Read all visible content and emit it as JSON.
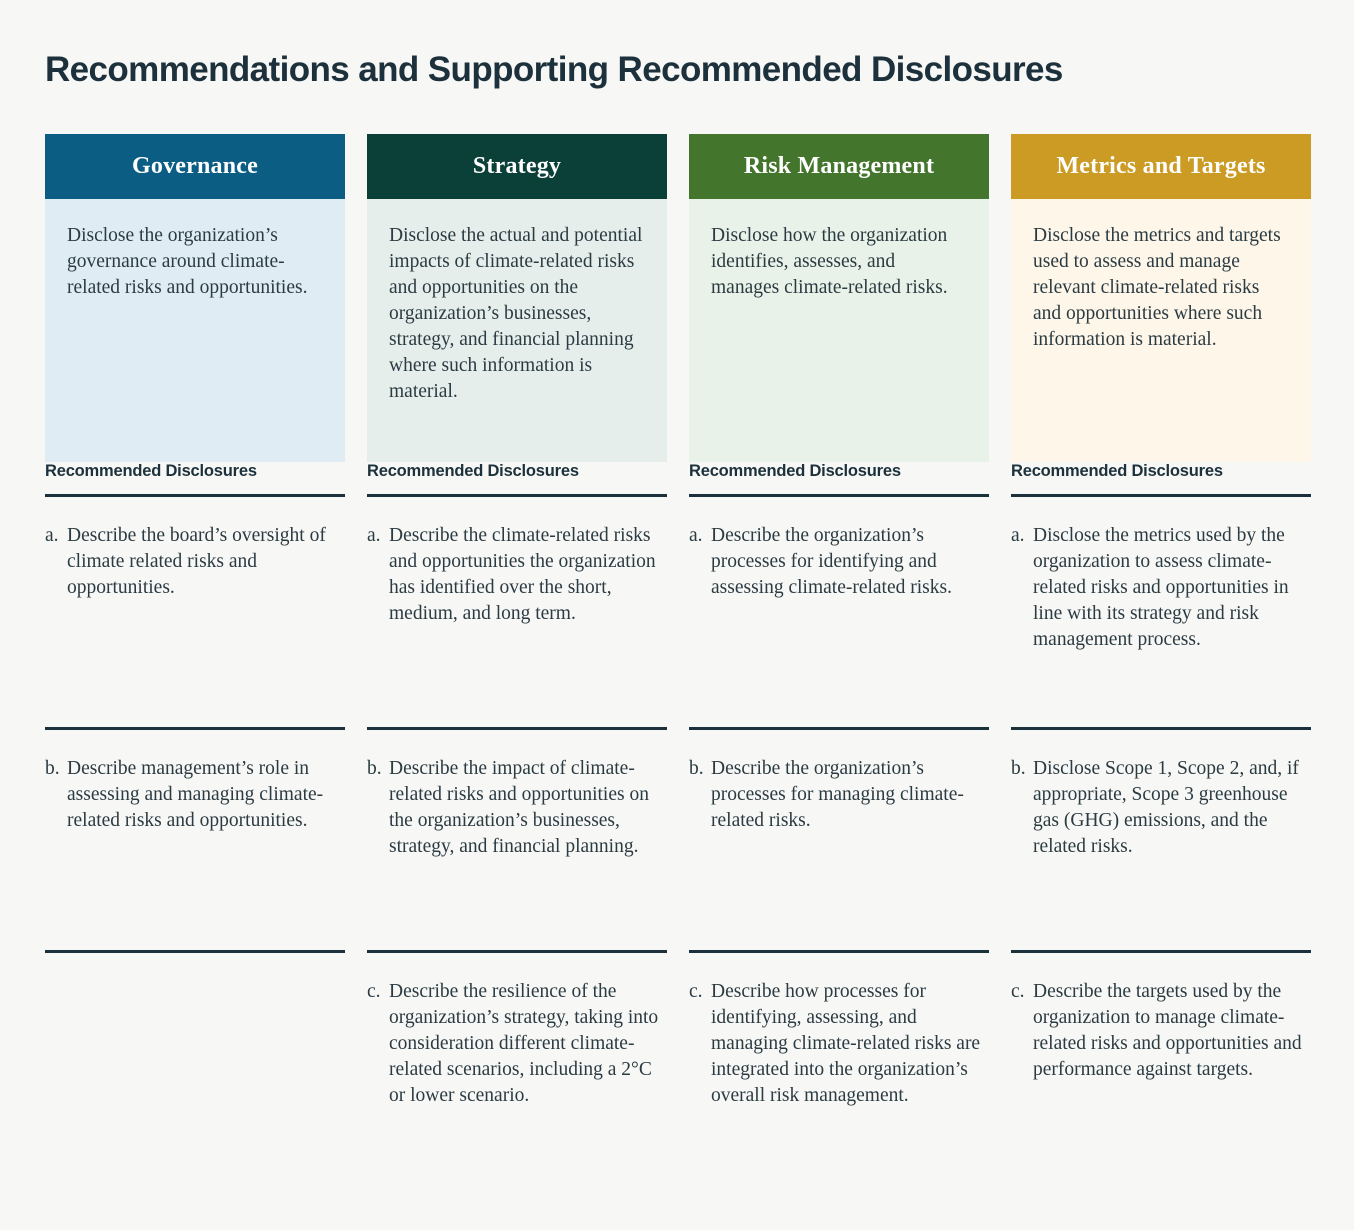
{
  "page": {
    "title": "Recommendations and Supporting Recommended Disclosures",
    "background_color": "#f7f7f5",
    "text_color": "#2b3b42",
    "rule_color": "#1c313c"
  },
  "columns": [
    {
      "id": "governance",
      "header": "Governance",
      "header_bg": "#0b5d84",
      "panel_bg": "#e0ecf4",
      "description": "Disclose the organization’s governance around climate- related risks and opportunities.",
      "disclosures_title": "Recommended Disclosures",
      "items": [
        {
          "marker": "a.",
          "text": "Describe the board’s oversight of climate related risks and opportunities."
        },
        {
          "marker": "b.",
          "text": "Describe management’s role in assessing and managing climate-related risks and opportunities."
        },
        {
          "marker": "",
          "text": ""
        }
      ]
    },
    {
      "id": "strategy",
      "header": "Strategy",
      "header_bg": "#0a4038",
      "panel_bg": "#e5eeeb",
      "description": "Disclose the actual and potential impacts of climate-related risks and opportunities on the organization’s businesses, strategy, and financial planning where such information is material.",
      "disclosures_title": "Recommended Disclosures",
      "items": [
        {
          "marker": "a.",
          "text": "Describe the climate-related risks and opportunities the organization has identified over the short, medium, and long term."
        },
        {
          "marker": "b.",
          "text": "Describe the impact of climate-related risks and opportunities on the organization’s businesses, strategy, and financial planning."
        },
        {
          "marker": "c.",
          "text": "Describe the resilience of the organization’s strategy, taking into consideration different climate-related scenarios, including a 2°C or lower scenario."
        }
      ]
    },
    {
      "id": "risk-management",
      "header": "Risk Management",
      "header_bg": "#44752c",
      "panel_bg": "#e9f2e8",
      "description": "Disclose how the organization identifies, assesses, and manages climate-related risks.",
      "disclosures_title": "Recommended Disclosures",
      "items": [
        {
          "marker": "a.",
          "text": "Describe the organization’s processes for identifying and assessing climate-related risks."
        },
        {
          "marker": "b.",
          "text": "Describe the organization’s processes for managing climate-related risks."
        },
        {
          "marker": "c.",
          "text": "Describe how processes for identifying, assessing, and managing climate-related risks are integrated into the organization’s overall risk management."
        }
      ]
    },
    {
      "id": "metrics-and-targets",
      "header": "Metrics and Targets",
      "header_bg": "#cb9b24",
      "panel_bg": "#fdf6e9",
      "description": "Disclose the metrics and targets used to assess and manage relevant climate-related risks and opportunities where such information is material.",
      "disclosures_title": "Recommended Disclosures",
      "items": [
        {
          "marker": "a.",
          "text": "Disclose the metrics used by the organization to assess climate-related risks and opportunities in line with its strategy and risk management process."
        },
        {
          "marker": "b.",
          "text": "Disclose Scope 1, Scope 2, and, if appropriate, Scope 3 greenhouse gas (GHG) emissions, and the related risks."
        },
        {
          "marker": "c.",
          "text": "Describe the targets used by the organization to manage climate-related risks and opportunities and performance against targets."
        }
      ]
    }
  ]
}
